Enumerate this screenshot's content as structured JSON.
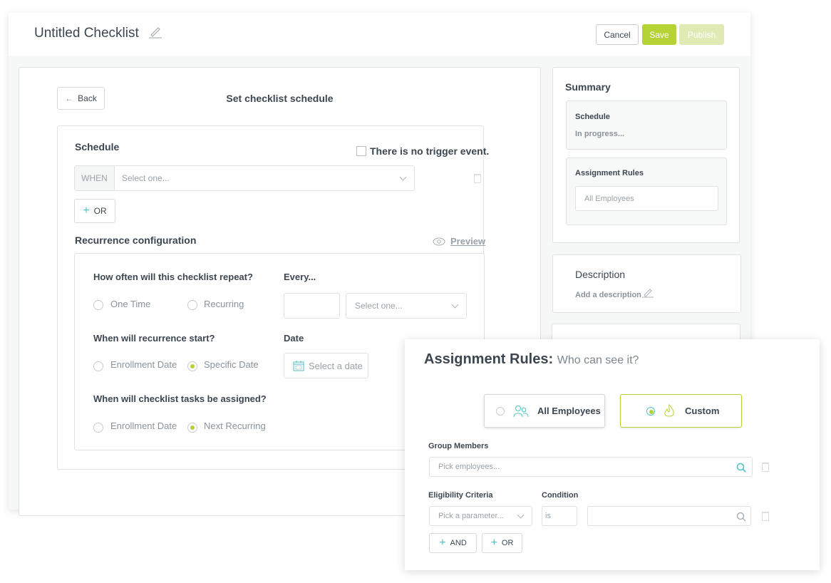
{
  "header": {
    "title": "Untitled Checklist",
    "cancel": "Cancel",
    "save": "Save",
    "publish": "Publish"
  },
  "colors": {
    "accent": "#b5d334",
    "accent_light": "#dfeab4",
    "teal": "#4fc1c4"
  },
  "main": {
    "back": "Back",
    "page_title": "Set checklist schedule",
    "schedule": {
      "label": "Schedule",
      "no_trigger": "There is no trigger event.",
      "no_trigger_checked": false,
      "when": "WHEN",
      "select_placeholder": "Select one...",
      "or": "OR"
    },
    "recurrence": {
      "label": "Recurrence configuration",
      "preview": "Preview",
      "q1": "How often will this checklist repeat?",
      "q1_options": [
        "One Time",
        "Recurring"
      ],
      "q1_selected": null,
      "every": "Every...",
      "every_value": "",
      "every_unit_placeholder": "Select one...",
      "q2": "When will recurrence start?",
      "q2_options": [
        "Enrollment Date",
        "Specific Date"
      ],
      "q2_selected": "Specific Date",
      "date_label": "Date",
      "date_placeholder": "Select a date",
      "q3": "When will checklist tasks be assigned?",
      "q3_options": [
        "Enrollment Date",
        "Next Recurring"
      ],
      "q3_selected": "Next Recurring"
    }
  },
  "sidebar": {
    "summary": "Summary",
    "schedule_label": "Schedule",
    "schedule_status": "In progress...",
    "assignment_label": "Assignment Rules",
    "assignment_value": "All Employees",
    "description_title": "Description",
    "description_add": "Add a description"
  },
  "assignment_modal": {
    "title": "Assignment Rules:",
    "subtitle": "Who can see it?",
    "options": [
      "All Employees",
      "Custom"
    ],
    "selected": "Custom",
    "group_members": "Group Members",
    "group_placeholder": "Pick employees...",
    "eligibility": "Eligibility Criteria",
    "condition": "Condition",
    "parameter_placeholder": "Pick a parameter...",
    "condition_value": "is",
    "value": "",
    "and": "AND",
    "or": "OR"
  }
}
